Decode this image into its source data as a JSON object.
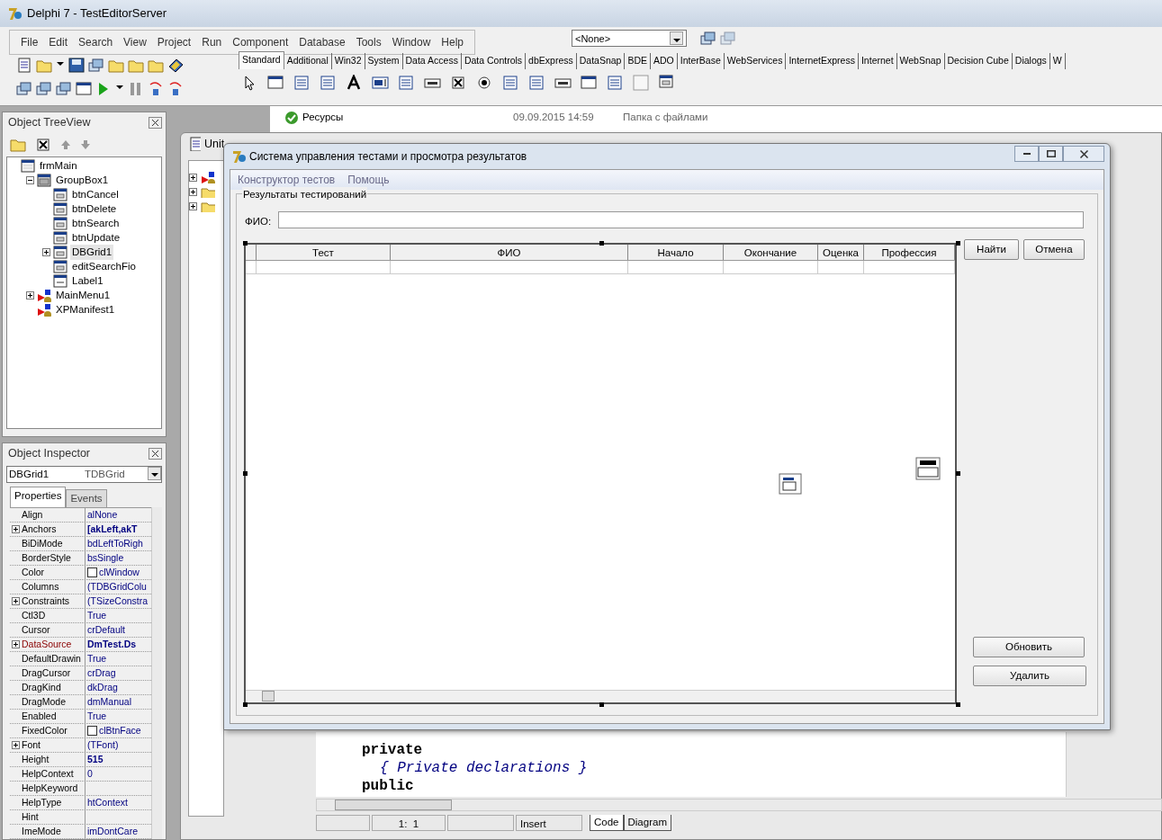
{
  "ide": {
    "title": "Delphi 7 - TestEditorServer",
    "menu": [
      "File",
      "Edit",
      "Search",
      "View",
      "Project",
      "Run",
      "Component",
      "Database",
      "Tools",
      "Window",
      "Help"
    ],
    "desktop_combo": "<None>",
    "palette_tabs": [
      {
        "label": "Standard",
        "selected": true
      },
      {
        "label": "Additional",
        "selected": false
      },
      {
        "label": "Win32",
        "selected": false
      },
      {
        "label": "System",
        "selected": false
      },
      {
        "label": "Data Access",
        "selected": false
      },
      {
        "label": "Data Controls",
        "selected": false
      },
      {
        "label": "dbExpress",
        "selected": false
      },
      {
        "label": "DataSnap",
        "selected": false
      },
      {
        "label": "BDE",
        "selected": false
      },
      {
        "label": "ADO",
        "selected": false
      },
      {
        "label": "InterBase",
        "selected": false
      },
      {
        "label": "WebServices",
        "selected": false
      },
      {
        "label": "InternetExpress",
        "selected": false
      },
      {
        "label": "Internet",
        "selected": false
      },
      {
        "label": "WebSnap",
        "selected": false
      },
      {
        "label": "Decision Cube",
        "selected": false
      },
      {
        "label": "Dialogs",
        "selected": false
      },
      {
        "label": "W",
        "selected": false
      }
    ]
  },
  "tree_view": {
    "title": "Object TreeView",
    "nodes": [
      {
        "label": "frmMain",
        "kind": "form",
        "selected": false,
        "children": [
          {
            "label": "GroupBox1",
            "kind": "group",
            "selected": false,
            "expanded": true,
            "children": [
              {
                "label": "btnCancel",
                "kind": "control",
                "selected": false
              },
              {
                "label": "btnDelete",
                "kind": "control",
                "selected": false
              },
              {
                "label": "btnSearch",
                "kind": "control",
                "selected": false
              },
              {
                "label": "btnUpdate",
                "kind": "control",
                "selected": false
              },
              {
                "label": "DBGrid1",
                "kind": "control",
                "selected": true,
                "expanded": false
              },
              {
                "label": "editSearchFio",
                "kind": "control",
                "selected": false
              },
              {
                "label": "Label1",
                "kind": "label",
                "selected": false
              }
            ]
          },
          {
            "label": "MainMenu1",
            "kind": "nonvisual",
            "selected": false,
            "expanded": false
          },
          {
            "label": "XPManifest1",
            "kind": "nonvisual",
            "selected": false
          }
        ]
      }
    ]
  },
  "inspector": {
    "title": "Object Inspector",
    "object": "DBGrid1",
    "type": "TDBGrid",
    "tabs": [
      {
        "label": "Properties",
        "selected": true
      },
      {
        "label": "Events",
        "selected": false
      }
    ],
    "properties": [
      {
        "name": "Align",
        "value": "alNone"
      },
      {
        "name": "Anchors",
        "value": "[akLeft,akT",
        "expandable": true,
        "modified": true
      },
      {
        "name": "BiDiMode",
        "value": "bdLeftToRigh"
      },
      {
        "name": "BorderStyle",
        "value": "bsSingle"
      },
      {
        "name": "Color",
        "value": "clWindow",
        "swatch": true
      },
      {
        "name": "Columns",
        "value": "(TDBGridColu"
      },
      {
        "name": "Constraints",
        "value": "(TSizeConstra",
        "expandable": true
      },
      {
        "name": "Ctl3D",
        "value": "True"
      },
      {
        "name": "Cursor",
        "value": "crDefault"
      },
      {
        "name": "DataSource",
        "value": "DmTest.Ds",
        "expandable": true,
        "modified": true,
        "reference": true
      },
      {
        "name": "DefaultDrawin",
        "value": "True"
      },
      {
        "name": "DragCursor",
        "value": "crDrag"
      },
      {
        "name": "DragKind",
        "value": "dkDrag"
      },
      {
        "name": "DragMode",
        "value": "dmManual"
      },
      {
        "name": "Enabled",
        "value": "True"
      },
      {
        "name": "FixedColor",
        "value": "clBtnFace",
        "swatch": true
      },
      {
        "name": "Font",
        "value": "(TFont)",
        "expandable": true
      },
      {
        "name": "Height",
        "value": "515",
        "modified": true
      },
      {
        "name": "HelpContext",
        "value": "0"
      },
      {
        "name": "HelpKeyword"
      },
      {
        "name": "HelpType",
        "value": "htContext"
      },
      {
        "name": "Hint"
      },
      {
        "name": "ImeMode",
        "value": "imDontCare"
      }
    ]
  },
  "explorer_row": {
    "name": "Ресурсы",
    "date": "09.09.2015 14:59",
    "type": "Папка с файлами"
  },
  "unit_window": {
    "title": "Unit",
    "code": [
      {
        "text": "private",
        "kind": "keyword"
      },
      {
        "text": "{ Private declarations }",
        "kind": "comment"
      },
      {
        "text": "public",
        "kind": "keyword"
      }
    ],
    "status": {
      "position": "1:  1",
      "mode": "Insert"
    },
    "tabs": [
      {
        "label": "Code",
        "selected": true
      },
      {
        "label": "Diagram",
        "selected": false
      }
    ]
  },
  "form": {
    "title": "Система управления тестами и просмотра результатов",
    "menu": [
      "Конструктор тестов",
      "Помощь"
    ],
    "group_caption": "Результаты тестирований",
    "search_label": "ФИО:",
    "columns": [
      "Тест",
      "ФИО",
      "Начало",
      "Окончание",
      "Оценка",
      "Профессия"
    ],
    "buttons_top": [
      "Найти",
      "Отмена"
    ],
    "buttons_bottom": [
      "Обновить",
      "Удалить"
    ]
  }
}
